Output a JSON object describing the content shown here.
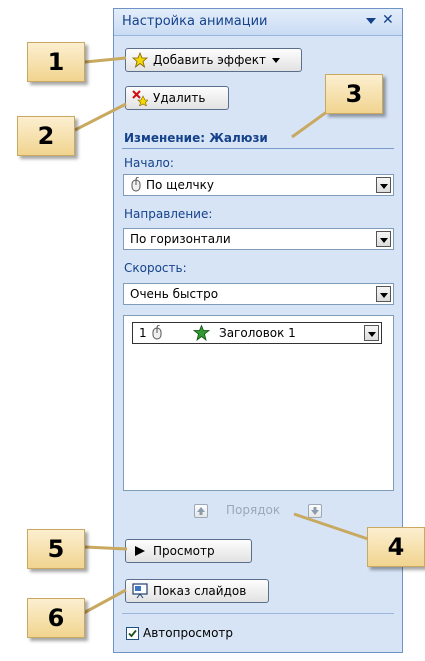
{
  "pane": {
    "title": "Настройка анимации",
    "add_effect_label": "Добавить эффект",
    "remove_label": "Удалить",
    "change_section_title": "Изменение: Жалюзи",
    "start": {
      "label": "Начало:",
      "value": "По щелчку"
    },
    "direction": {
      "label": "Направление:",
      "value": "По горизонтали"
    },
    "speed": {
      "label": "Скорость:",
      "value": "Очень быстро"
    },
    "effects_list": [
      {
        "number": "1",
        "name": "Заголовок 1"
      }
    ],
    "order_label": "Порядок",
    "preview_label": "Просмотр",
    "slideshow_label": "Показ слайдов",
    "autopreview": {
      "label": "Автопросмотр",
      "checked": true
    }
  },
  "callouts": [
    "1",
    "2",
    "3",
    "4",
    "5",
    "6"
  ],
  "colors": {
    "pane_bg": "#d6e4f6",
    "title_text": "#15428b",
    "callout_bg": "#f1d48f"
  }
}
